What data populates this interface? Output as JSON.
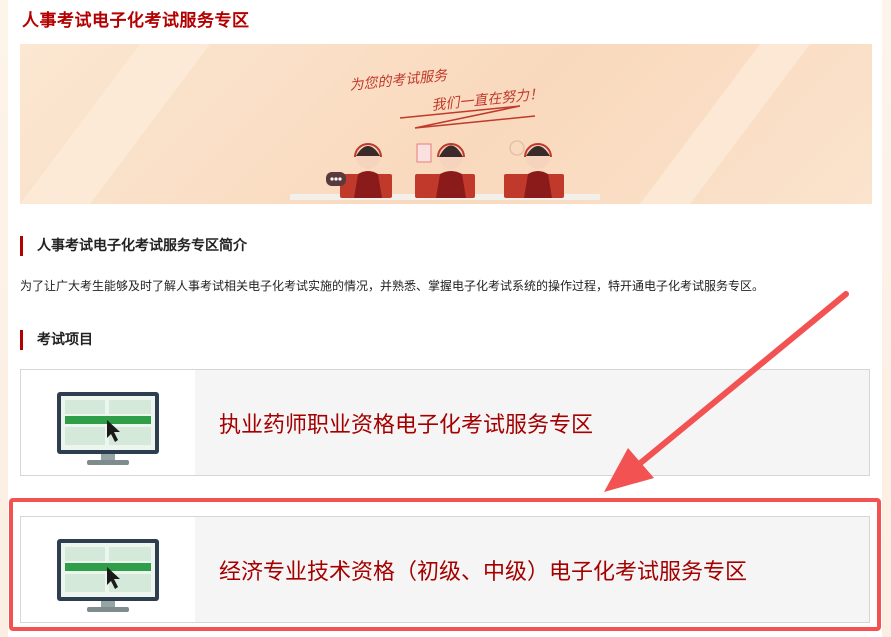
{
  "page": {
    "title": "人事考试电子化考试服务专区"
  },
  "banner": {
    "line1": "为您的考试服务",
    "line2": "我们一直在努力！"
  },
  "intro": {
    "heading": "人事考试电子化考试服务专区简介",
    "text": "为了让广大考生能够及时了解人事考试相关电子化考试实施的情况，并熟悉、掌握电子化考试系统的操作过程，特开通电子化考试服务专区。"
  },
  "exams": {
    "heading": "考试项目",
    "items": [
      {
        "label": "执业药师职业资格电子化考试服务专区"
      },
      {
        "label": "经济专业技术资格（初级、中级）电子化考试服务专区"
      }
    ]
  },
  "colors": {
    "accent": "#b30000",
    "highlight": "#f25252",
    "banner_bg": "#f9d9bd"
  }
}
